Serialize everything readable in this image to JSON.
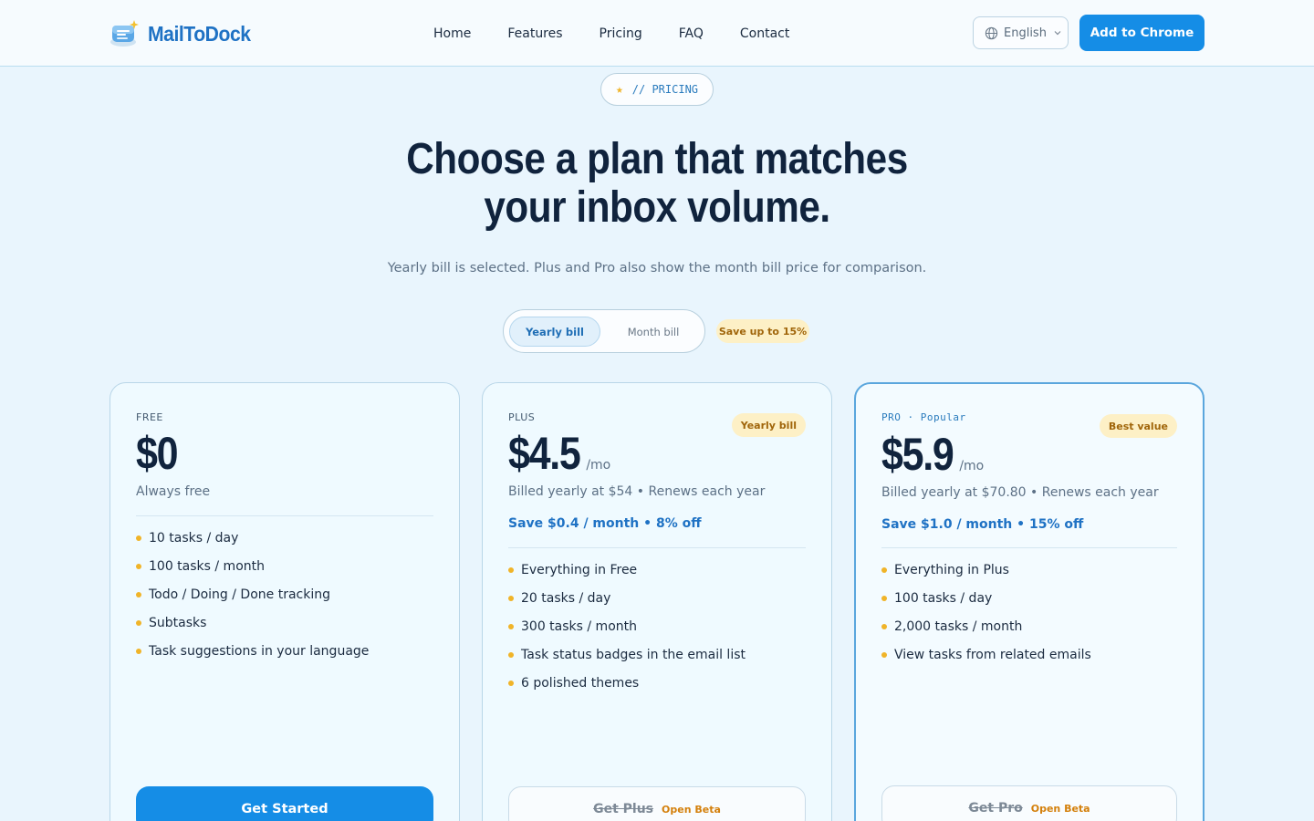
{
  "header": {
    "logo_text": "MailToDock",
    "nav": [
      "Home",
      "Features",
      "Pricing",
      "FAQ",
      "Contact"
    ],
    "language": "English",
    "cta_label": "Add to Chrome"
  },
  "hero": {
    "eyebrow": "// PRICING",
    "title_line1": "Choose a plan that matches",
    "title_line2": "your inbox volume.",
    "subtitle": "Yearly bill is selected. Plus and Pro also show the month bill price for comparison."
  },
  "billing_toggle": {
    "yearly_label": "Yearly bill",
    "monthly_label": "Month bill",
    "selected": "yearly",
    "save_badge": "Save up to 15%"
  },
  "plans": [
    {
      "tier": "FREE",
      "price": "$0",
      "per": "",
      "billed": "Always free",
      "savings": "",
      "tag": "",
      "features": [
        "10 tasks / day",
        "100 tasks / month",
        "Todo / Doing / Done tracking",
        "Subtasks",
        "Task suggestions in your language"
      ],
      "button_label": "Get Started",
      "beta_label": ""
    },
    {
      "tier": "PLUS",
      "price": "$4.5",
      "per": "/mo",
      "billed": "Billed yearly at $54 • Renews each year",
      "savings": "Save $0.4 / month • 8% off",
      "tag": "Yearly bill",
      "features": [
        "Everything in Free",
        "20 tasks / day",
        "300 tasks / month",
        "Task status badges in the email list",
        "6 polished themes"
      ],
      "button_label": "Get Plus",
      "beta_label": "Open Beta"
    },
    {
      "tier": "PRO · Popular",
      "price": "$5.9",
      "per": "/mo",
      "billed": "Billed yearly at $70.80 • Renews each year",
      "savings": "Save $1.0 / month • 15% off",
      "tag": "Best value",
      "features": [
        "Everything in Plus",
        "100 tasks / day",
        "2,000 tasks / month",
        "View tasks from related emails"
      ],
      "button_label": "Get Pro",
      "beta_label": "Open Beta"
    }
  ],
  "colors": {
    "accent": "#158de6",
    "background": "#e9f5fd",
    "heading": "#10233d",
    "badge_bg": "#fdf0c6",
    "badge_text": "#a0650a",
    "bullet": "#f0b429"
  }
}
